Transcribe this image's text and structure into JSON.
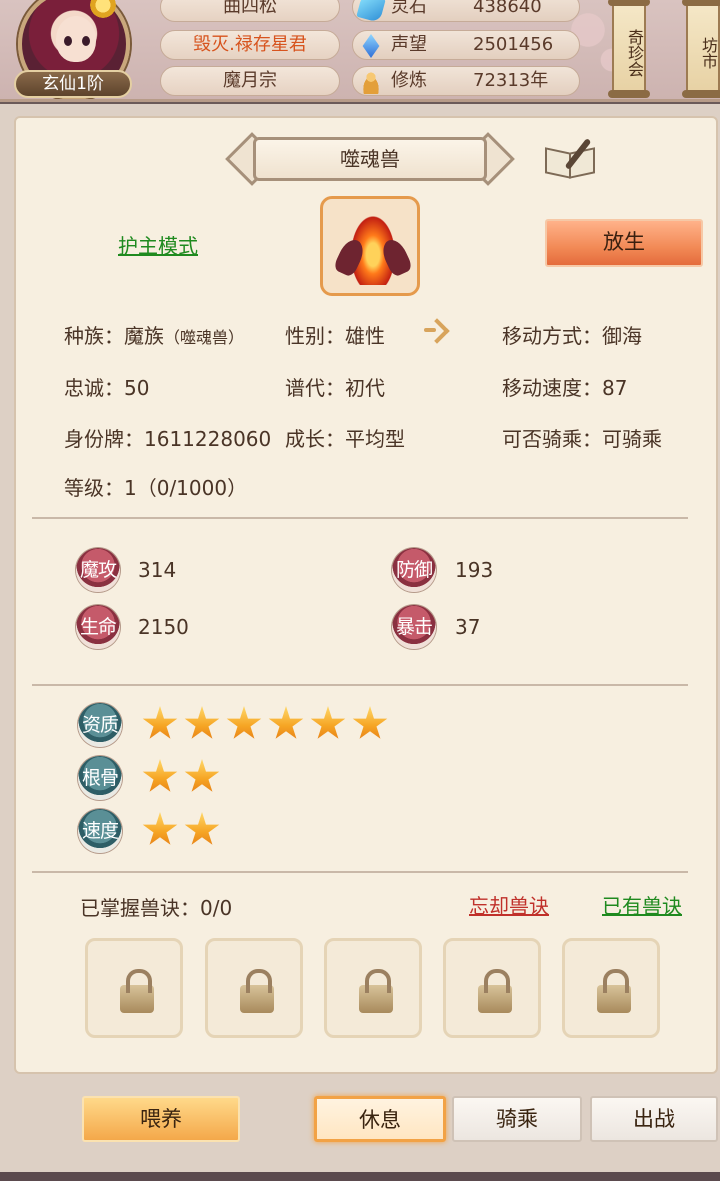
{
  "header": {
    "player_rank": "玄仙1阶",
    "name_top": "曲四松",
    "title": "毁灭.禄存星君",
    "sect": "魔月宗",
    "resources": [
      {
        "icon": "spirit-stone-icon",
        "label": "灵石",
        "value": "438640"
      },
      {
        "icon": "prestige-crystal-icon",
        "label": "声望",
        "value": "2501456"
      },
      {
        "icon": "cultivation-monk-icon",
        "label": "修炼",
        "value": "72313年"
      }
    ],
    "side_buttons": [
      "奇珍会",
      "坊市"
    ]
  },
  "pet": {
    "name": "噬魂兽",
    "guard_mode": "护主模式",
    "release": "放生",
    "attributes": {
      "race_label": "种族：",
      "race_value": "魔族",
      "race_sub": "（噬魂兽）",
      "gender": "性别：雄性",
      "move_mode": "移动方式：御海",
      "loyalty": "忠诚：50",
      "generation": "谱代：初代",
      "move_speed": "移动速度：87",
      "id_tag": "身份牌：1611228060",
      "growth": "成长：平均型",
      "rideable": "可否骑乘：可骑乘",
      "level": "等级：1（0/1000）"
    },
    "stats": [
      {
        "badge": "魔攻",
        "value": "314"
      },
      {
        "badge": "防御",
        "value": "193"
      },
      {
        "badge": "生命",
        "value": "2150"
      },
      {
        "badge": "暴击",
        "value": "37"
      }
    ],
    "ratings": [
      {
        "badge": "资质",
        "stars": 6
      },
      {
        "badge": "根骨",
        "stars": 2
      },
      {
        "badge": "速度",
        "stars": 2
      }
    ],
    "skills": {
      "mastered": "已掌握兽诀：0/0",
      "forget": "忘却兽诀",
      "owned": "已有兽诀",
      "slots": 5
    }
  },
  "actions": {
    "feed": "喂养",
    "rest": "休息",
    "ride": "骑乘",
    "battle": "出战"
  },
  "colors": {
    "accent_orange": "#f28a56",
    "link_green": "#1f8a1f",
    "link_red": "#c0302a",
    "star": "#f6a524"
  }
}
